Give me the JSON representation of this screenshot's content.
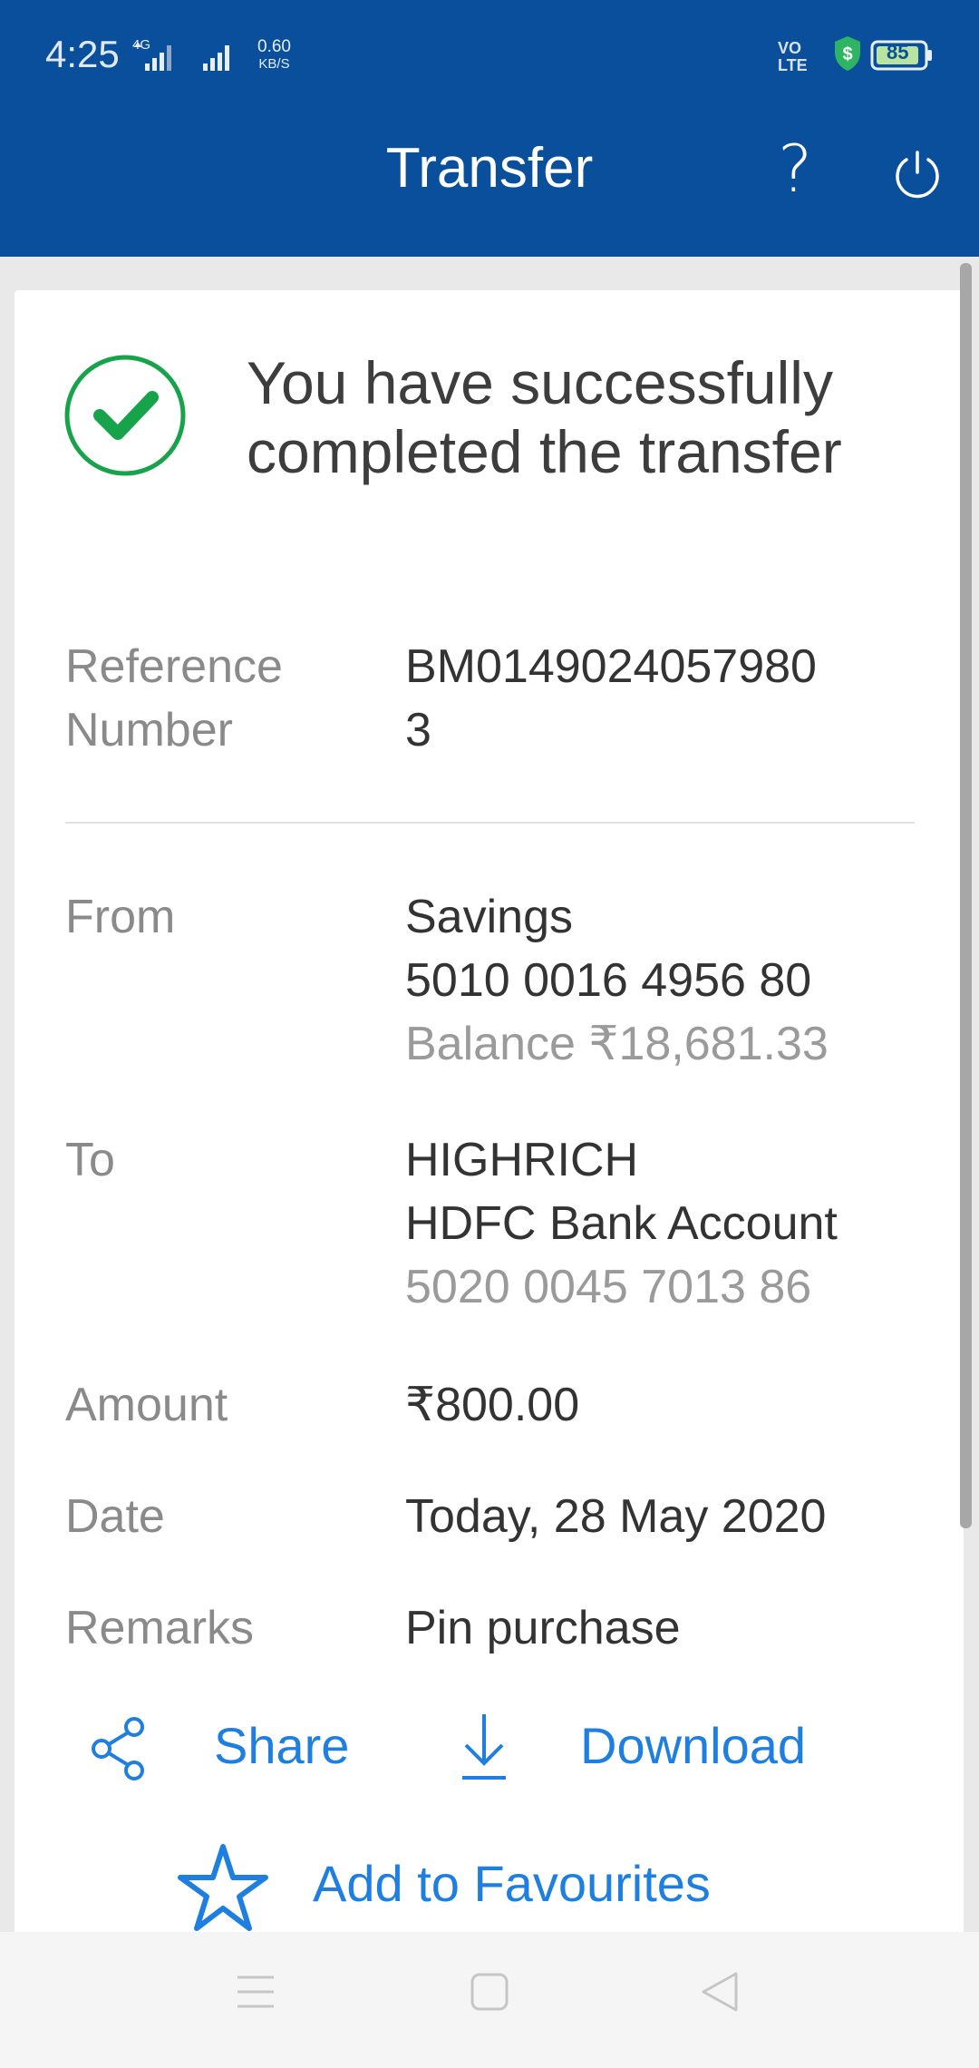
{
  "status_bar": {
    "time": "4:25",
    "network_type": "4G",
    "data_speed_value": "0.60",
    "data_speed_unit": "KB/S",
    "volte_line1": "VO",
    "volte_line2": "LTE",
    "battery_level": "85"
  },
  "header": {
    "title": "Transfer",
    "help_label": "?"
  },
  "success": {
    "message": "You have successfully completed the transfer"
  },
  "details": {
    "reference": {
      "label_line1": "Reference",
      "label_line2": "Number",
      "value_line1": "BM0149024057980",
      "value_line2": "3"
    },
    "from": {
      "label": "From",
      "account_type": "Savings",
      "account_number": "5010 0016 4956 80",
      "balance": "Balance ₹18,681.33"
    },
    "to": {
      "label": "To",
      "name": "HIGHRICH",
      "bank": "HDFC Bank Account",
      "account_number": "5020 0045 7013 86"
    },
    "amount": {
      "label": "Amount",
      "value": "₹800.00"
    },
    "date": {
      "label": "Date",
      "value": "Today, 28 May 2020"
    },
    "remarks": {
      "label": "Remarks",
      "value": "Pin purchase"
    }
  },
  "actions": {
    "share": "Share",
    "download": "Download",
    "favourites": "Add to Favourites"
  },
  "colors": {
    "header_blue": "#0a4f9c",
    "success_green": "#16a34a",
    "link_blue": "#1e7fe0"
  },
  "icons": [
    "signal-icon",
    "shield-icon",
    "battery-icon",
    "power-icon",
    "check-circle-icon",
    "share-icon",
    "download-icon",
    "star-icon",
    "menu-icon",
    "home-icon",
    "back-icon"
  ]
}
